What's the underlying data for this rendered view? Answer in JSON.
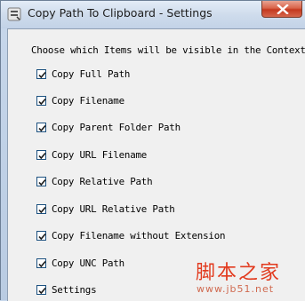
{
  "window": {
    "title": "Copy Path To Clipboard - Settings",
    "icon": "app-icon",
    "close_icon": "close-icon"
  },
  "settings": {
    "intro": "Choose which Items will be visible in the Context M",
    "options": [
      {
        "label": "Copy Full Path",
        "checked": true
      },
      {
        "label": "Copy Filename",
        "checked": true
      },
      {
        "label": "Copy Parent Folder Path",
        "checked": true
      },
      {
        "label": "Copy URL Filename",
        "checked": true
      },
      {
        "label": "Copy Relative Path",
        "checked": true
      },
      {
        "label": "Copy URL Relative Path",
        "checked": true
      },
      {
        "label": "Copy Filename without Extension",
        "checked": true
      },
      {
        "label": "Copy UNC Path",
        "checked": true
      },
      {
        "label": "Settings",
        "checked": true
      }
    ]
  },
  "watermark": {
    "text": "脚本之家",
    "url": "www.jb51.net"
  },
  "colors": {
    "close_button": "#c4391f",
    "checkbox_border": "#1c5180",
    "watermark": "#e23a1e"
  }
}
